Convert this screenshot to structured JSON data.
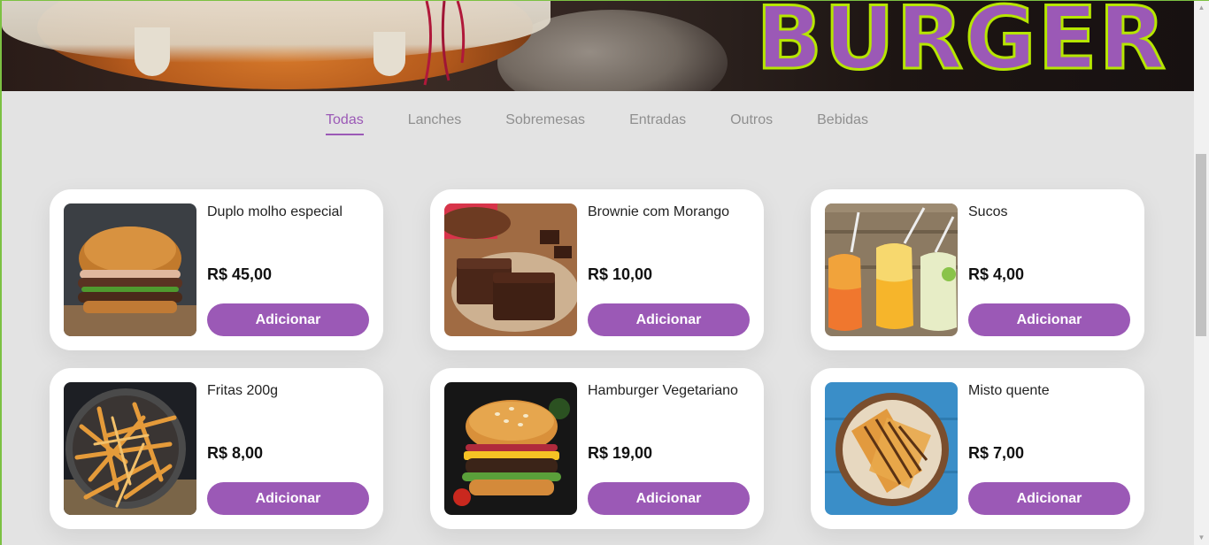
{
  "banner": {
    "logo_text": "BURGER",
    "accent": "#9b59b6",
    "outline": "#b6e600"
  },
  "tabs": [
    {
      "label": "Todas",
      "active": true
    },
    {
      "label": "Lanches",
      "active": false
    },
    {
      "label": "Sobremesas",
      "active": false
    },
    {
      "label": "Entradas",
      "active": false
    },
    {
      "label": "Outros",
      "active": false
    },
    {
      "label": "Bebidas",
      "active": false
    }
  ],
  "products": [
    {
      "name": "Duplo molho especial",
      "price": "R$ 45,00",
      "button": "Adicionar",
      "image": "burger-photo"
    },
    {
      "name": "Brownie com Morango",
      "price": "R$ 10,00",
      "button": "Adicionar",
      "image": "brownie-photo"
    },
    {
      "name": "Sucos",
      "price": "R$ 4,00",
      "button": "Adicionar",
      "image": "juices-photo"
    },
    {
      "name": "Fritas 200g",
      "price": "R$ 8,00",
      "button": "Adicionar",
      "image": "fries-photo"
    },
    {
      "name": "Hamburger Vegetariano",
      "price": "R$ 19,00",
      "button": "Adicionar",
      "image": "veggie-burger-photo"
    },
    {
      "name": "Misto quente",
      "price": "R$ 7,00",
      "button": "Adicionar",
      "image": "grilled-sandwich-photo"
    }
  ],
  "colors": {
    "accent": "#9b59b6",
    "background": "#e3e3e3",
    "tab_inactive": "#8f8f8f"
  }
}
